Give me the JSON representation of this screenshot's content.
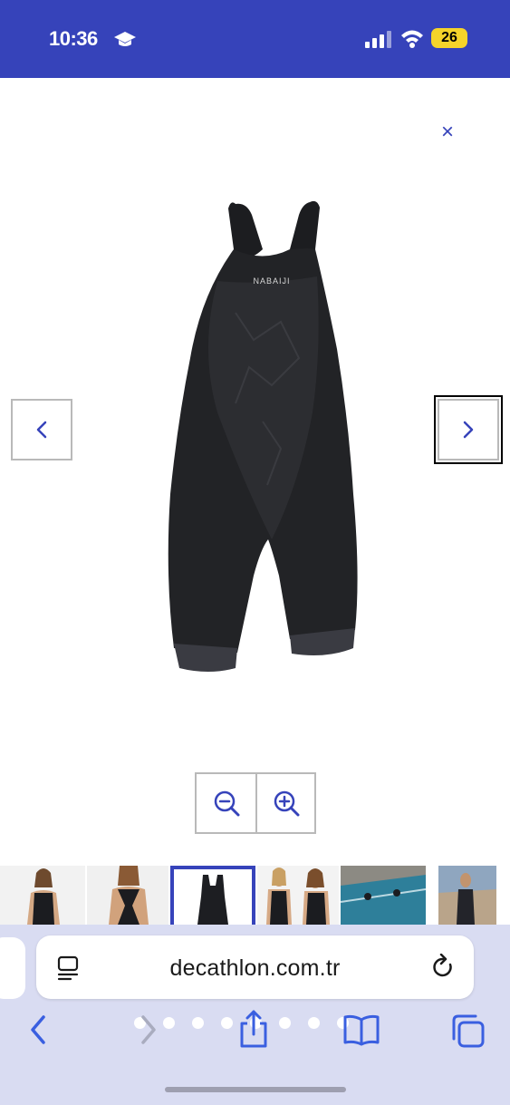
{
  "status_bar": {
    "time": "10:36",
    "battery": "26",
    "icons": [
      "graduation-cap-icon",
      "cellular-signal-icon",
      "wifi-icon",
      "battery-icon"
    ]
  },
  "viewer": {
    "close_label": "×",
    "prev_icon": "chevron-left-icon",
    "next_icon": "chevron-right-icon",
    "product_logo": "NABAIJI",
    "zoom_out_icon": "zoom-out-icon",
    "zoom_in_icon": "zoom-in-icon"
  },
  "thumbnails": [
    {
      "name": "thumb-model-front"
    },
    {
      "name": "thumb-model-back"
    },
    {
      "name": "thumb-product",
      "selected": true
    },
    {
      "name": "thumb-two-models"
    },
    {
      "name": "thumb-pool-scene"
    },
    {
      "name": "thumb-model-outdoor"
    }
  ],
  "browser": {
    "url": "decathlon.com.tr",
    "page_dots": 8,
    "active_dot": 3
  },
  "colors": {
    "brand_blue": "#3643ba",
    "toolbar_bg": "#d9dcf2"
  }
}
